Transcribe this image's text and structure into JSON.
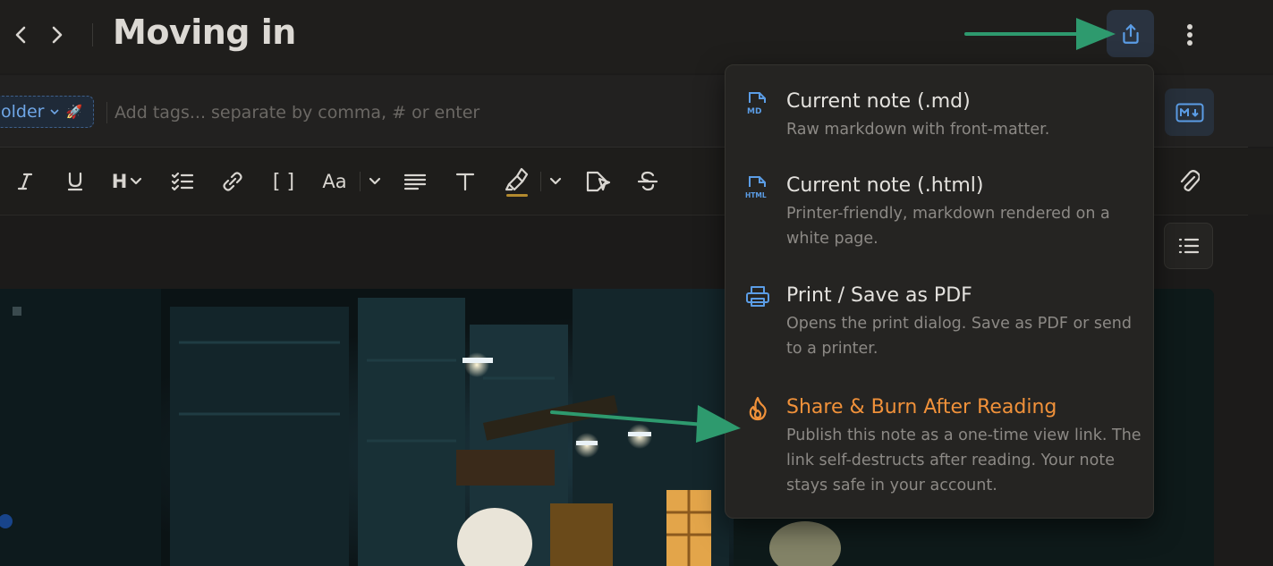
{
  "header": {
    "title": "Moving in",
    "back_icon": "chevron-left-icon",
    "forward_icon": "chevron-right-icon",
    "share_icon": "share-upload-icon",
    "more_icon": "more-vertical-icon"
  },
  "tags": {
    "folder_label": "older",
    "folder_emoji": "🚀",
    "input_placeholder": "Add tags... separate by comma, # or enter",
    "md_button_icon": "markdown-icon"
  },
  "toolbar": {
    "heading_label": "H",
    "font_label": "Aa",
    "brackets_label": "[ ]",
    "text_label": "T",
    "highlight_color": "#b38a2e"
  },
  "share_menu": {
    "items": [
      {
        "icon": "md-file-icon",
        "title": "Current note (.md)",
        "description": "Raw markdown with front-matter."
      },
      {
        "icon": "html-file-icon",
        "title": "Current note (.html)",
        "description": "Printer-friendly, markdown rendered on a white page."
      },
      {
        "icon": "printer-icon",
        "title": "Print / Save as PDF",
        "description": "Opens the print dialog. Save as PDF or send to a printer."
      },
      {
        "icon": "flame-icon",
        "title": "Share & Burn After Reading",
        "description": "Publish this note as a one-time view link. The link self-destructs after reading. Your note stays safe in your account."
      }
    ]
  },
  "colors": {
    "accent_blue": "#5b9de6",
    "burn_orange": "#f0913a",
    "annotation_arrow": "#2e9a6e"
  }
}
